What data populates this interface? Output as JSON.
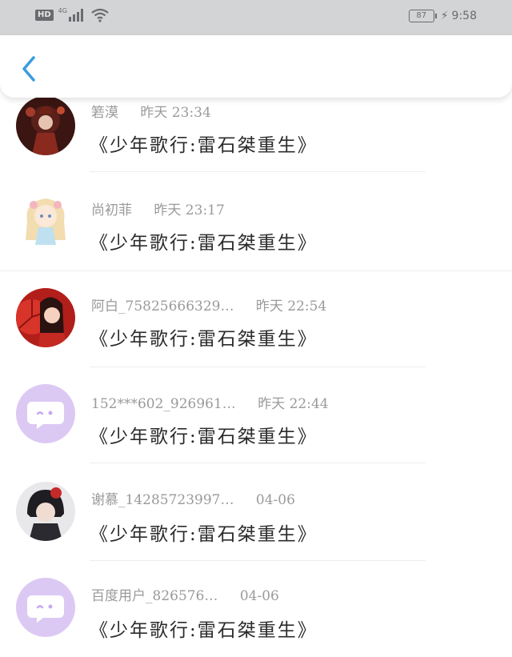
{
  "status_bar": {
    "hd": "HD",
    "network": "4G",
    "battery": "87",
    "time": "9:58",
    "icons": [
      "hd-icon",
      "signal-icon",
      "wifi-icon",
      "battery-icon",
      "charging-icon"
    ]
  },
  "header": {
    "back_icon": "chevron-left-icon",
    "accent_color": "#3a9be0"
  },
  "comments": [
    {
      "name": "箬漠",
      "time": "昨天 23:34",
      "text": "《少年歌行:雷石桀重生》",
      "avatar": "dark-red-illustration"
    },
    {
      "name": "尚初菲",
      "time": "昨天 23:17",
      "text": "《少年歌行:雷石桀重生》",
      "avatar": "chibi-girl"
    },
    {
      "name": "阿白_75825666329…",
      "time": "昨天 22:54",
      "text": "《少年歌行:雷石桀重生》",
      "avatar": "red-umbrella-girl"
    },
    {
      "name": "152***602_926961…",
      "time": "昨天 22:44",
      "text": "《少年歌行:雷石桀重生》",
      "avatar": "default-chat-bubble"
    },
    {
      "name": "谢慕_14285723997…",
      "time": "04-06",
      "text": "《少年歌行:雷石桀重生》",
      "avatar": "dark-hair-boy"
    },
    {
      "name": "百度用户_826576…",
      "time": "04-06",
      "text": "《少年歌行:雷石桀重生》",
      "avatar": "default-chat-bubble"
    }
  ],
  "colors": {
    "default_avatar_bg": "#dcc9f3",
    "name_gray": "#9a9a9a",
    "text_dark": "#2b2b2b"
  }
}
